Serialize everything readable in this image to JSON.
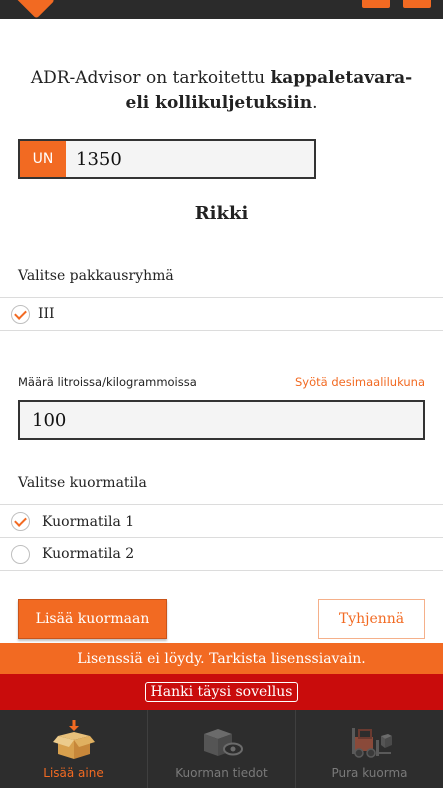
{
  "intro": {
    "text_plain": "ADR-Advisor on tarkoitettu ",
    "text_bold": "kappaletavara- eli kollikuljetuksiin",
    "text_end": "."
  },
  "un_field": {
    "label": "UN",
    "value": "1350"
  },
  "substance_name": "Rikki",
  "packing_group": {
    "heading": "Valitse pakkausryhmä",
    "options": [
      {
        "label": "III",
        "checked": true
      }
    ]
  },
  "amount": {
    "label": "Määrä litroissa/kilogrammoissa",
    "hint": "Syötä desimaalilukuna",
    "value": "100"
  },
  "load_space": {
    "heading": "Valitse kuormatila",
    "options": [
      {
        "label": "Kuormatila 1",
        "checked": true
      },
      {
        "label": "Kuormatila 2",
        "checked": false
      }
    ]
  },
  "buttons": {
    "add": "Lisää kuormaan",
    "clear": "Tyhjennä"
  },
  "license": {
    "message": "Lisenssiä ei löydy. Tarkista lisenssiavain.",
    "buy_label": "Hanki täysi sovellus"
  },
  "tabs": [
    {
      "label": "Lisää aine",
      "icon": "add-box-icon",
      "active": true
    },
    {
      "label": "Kuorman tiedot",
      "icon": "box-view-icon",
      "active": false
    },
    {
      "label": "Pura kuorma",
      "icon": "forklift-icon",
      "active": false
    }
  ],
  "colors": {
    "accent": "#f26a22",
    "alert": "#c90c0c",
    "tabbar": "#2d2d2d"
  }
}
